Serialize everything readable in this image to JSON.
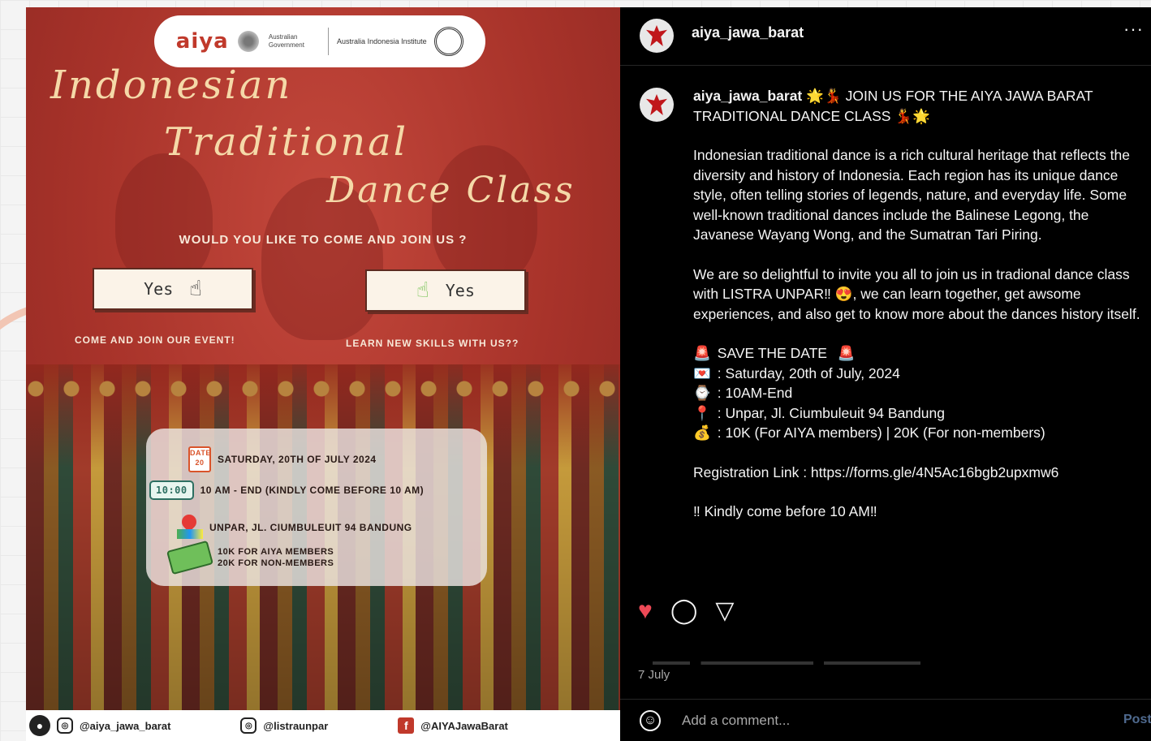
{
  "poster": {
    "logo": {
      "aiya": "aiya",
      "gov": "Australian Government",
      "aii": "Australia Indonesia Institute"
    },
    "title_lines": [
      "Indonesian",
      "Traditional",
      "Dance Class"
    ],
    "question": "WOULD YOU LIKE TO COME AND JOIN US ?",
    "buttons": [
      {
        "label": "Yes",
        "icon": "pointer-hand-icon"
      },
      {
        "label": "Yes",
        "icon": "pointer-hand-icon"
      }
    ],
    "taglines": [
      "COME AND JOIN OUR EVENT!",
      "LEARN NEW SKILLS WITH US??"
    ],
    "info": {
      "calendar_label": "DATE",
      "calendar_day": "20",
      "date": "SATURDAY, 20TH OF JULY 2024",
      "clock": "10:00",
      "time": "10 AM - END (KINDLY COME BEFORE 10 AM)",
      "location": "UNPAR, JL. CIUMBULEUIT 94 BANDUNG",
      "price_members": "10K FOR AIYA MEMBERS",
      "price_non_members": "20K FOR NON-MEMBERS"
    },
    "footer": {
      "instagram1": "@aiya_jawa_barat",
      "instagram2": "@listraunpar",
      "facebook": "@AIYAJawaBarat"
    }
  },
  "post": {
    "username": "aiya_jawa_barat",
    "more_icon": "more-options-icon",
    "caption_user": "aiya_jawa_barat",
    "caption_headline": "JOIN US FOR THE AIYA JAWA BARAT TRADITIONAL DANCE CLASS",
    "caption_p1": "Indonesian traditional dance is a rich cultural heritage that reflects the diversity and history of Indonesia. Each region has its unique dance style, often telling stories of legends, nature, and everyday life. Some well-known traditional dances include the Balinese Legong, the Javanese Wayang Wong, and the Sumatran Tari Piring.",
    "caption_p2_a": "We are so delightful to invite you all to join us in tradional dance class with LISTRA UNPAR‼",
    "caption_p2_b": ", we can learn together, get awsome experiences, and also get to know more about the dances history itself.",
    "save_the_date": "SAVE THE DATE",
    "details": [
      {
        "icon": "calendar-emoji",
        "text": ": Saturday, 20th of July, 2024"
      },
      {
        "icon": "clock-emoji",
        "text": ": 10AM-End"
      },
      {
        "icon": "pin-emoji",
        "text": ": Unpar, Jl. Ciumbuleuit 94 Bandung"
      },
      {
        "icon": "money-bag-emoji",
        "text": ": 10K (For AIYA members) | 20K (For non-members)"
      }
    ],
    "registration": "Registration Link : https://forms.gle/4N5Ac16bgb2upxmw6",
    "reminder": "‼ Kindly come before 10 AM‼",
    "date": "7 July",
    "comment_placeholder": "Add a comment...",
    "post_label": "Post",
    "accent_like": "#ed4956"
  }
}
